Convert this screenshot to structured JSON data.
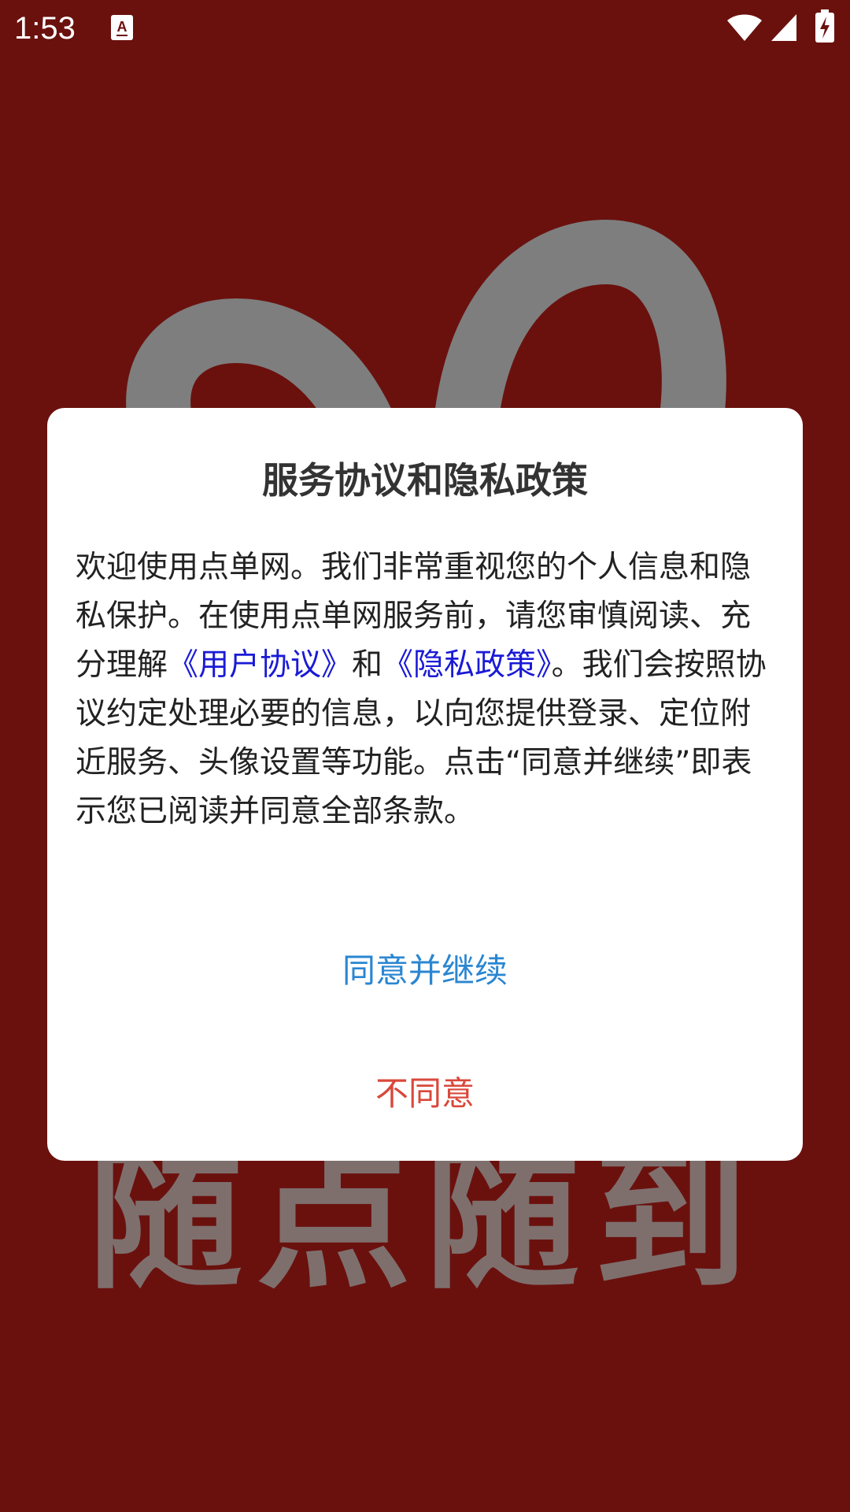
{
  "status_bar": {
    "time": "1:53",
    "icons": [
      "notification-a-icon",
      "wifi-icon",
      "cell-signal-icon",
      "battery-charging-icon"
    ]
  },
  "splash": {
    "slogan": "随点随到",
    "background_color": "#6a110e",
    "logo_color": "#7e7e7e"
  },
  "dialog": {
    "title": "服务协议和隐私政策",
    "body_part1": "欢迎使用点单网。我们非常重视您的个人信息和隐私保护。在使用点单网服务前，请您审慎阅读、充分理解",
    "user_agreement_link": "《用户协议》",
    "body_and": "和",
    "privacy_policy_link": "《隐私政策》",
    "body_part2": "。我们会按照协议约定处理必要的信息，以向您提供登录、定位附近服务、头像设置等功能。点击“同意并继续”即表示您已阅读并同意全部条款。",
    "agree_label": "同意并继续",
    "disagree_label": "不同意",
    "agree_color": "#2a86d1",
    "disagree_color": "#d9483b",
    "link_color": "#1a1ad6"
  }
}
